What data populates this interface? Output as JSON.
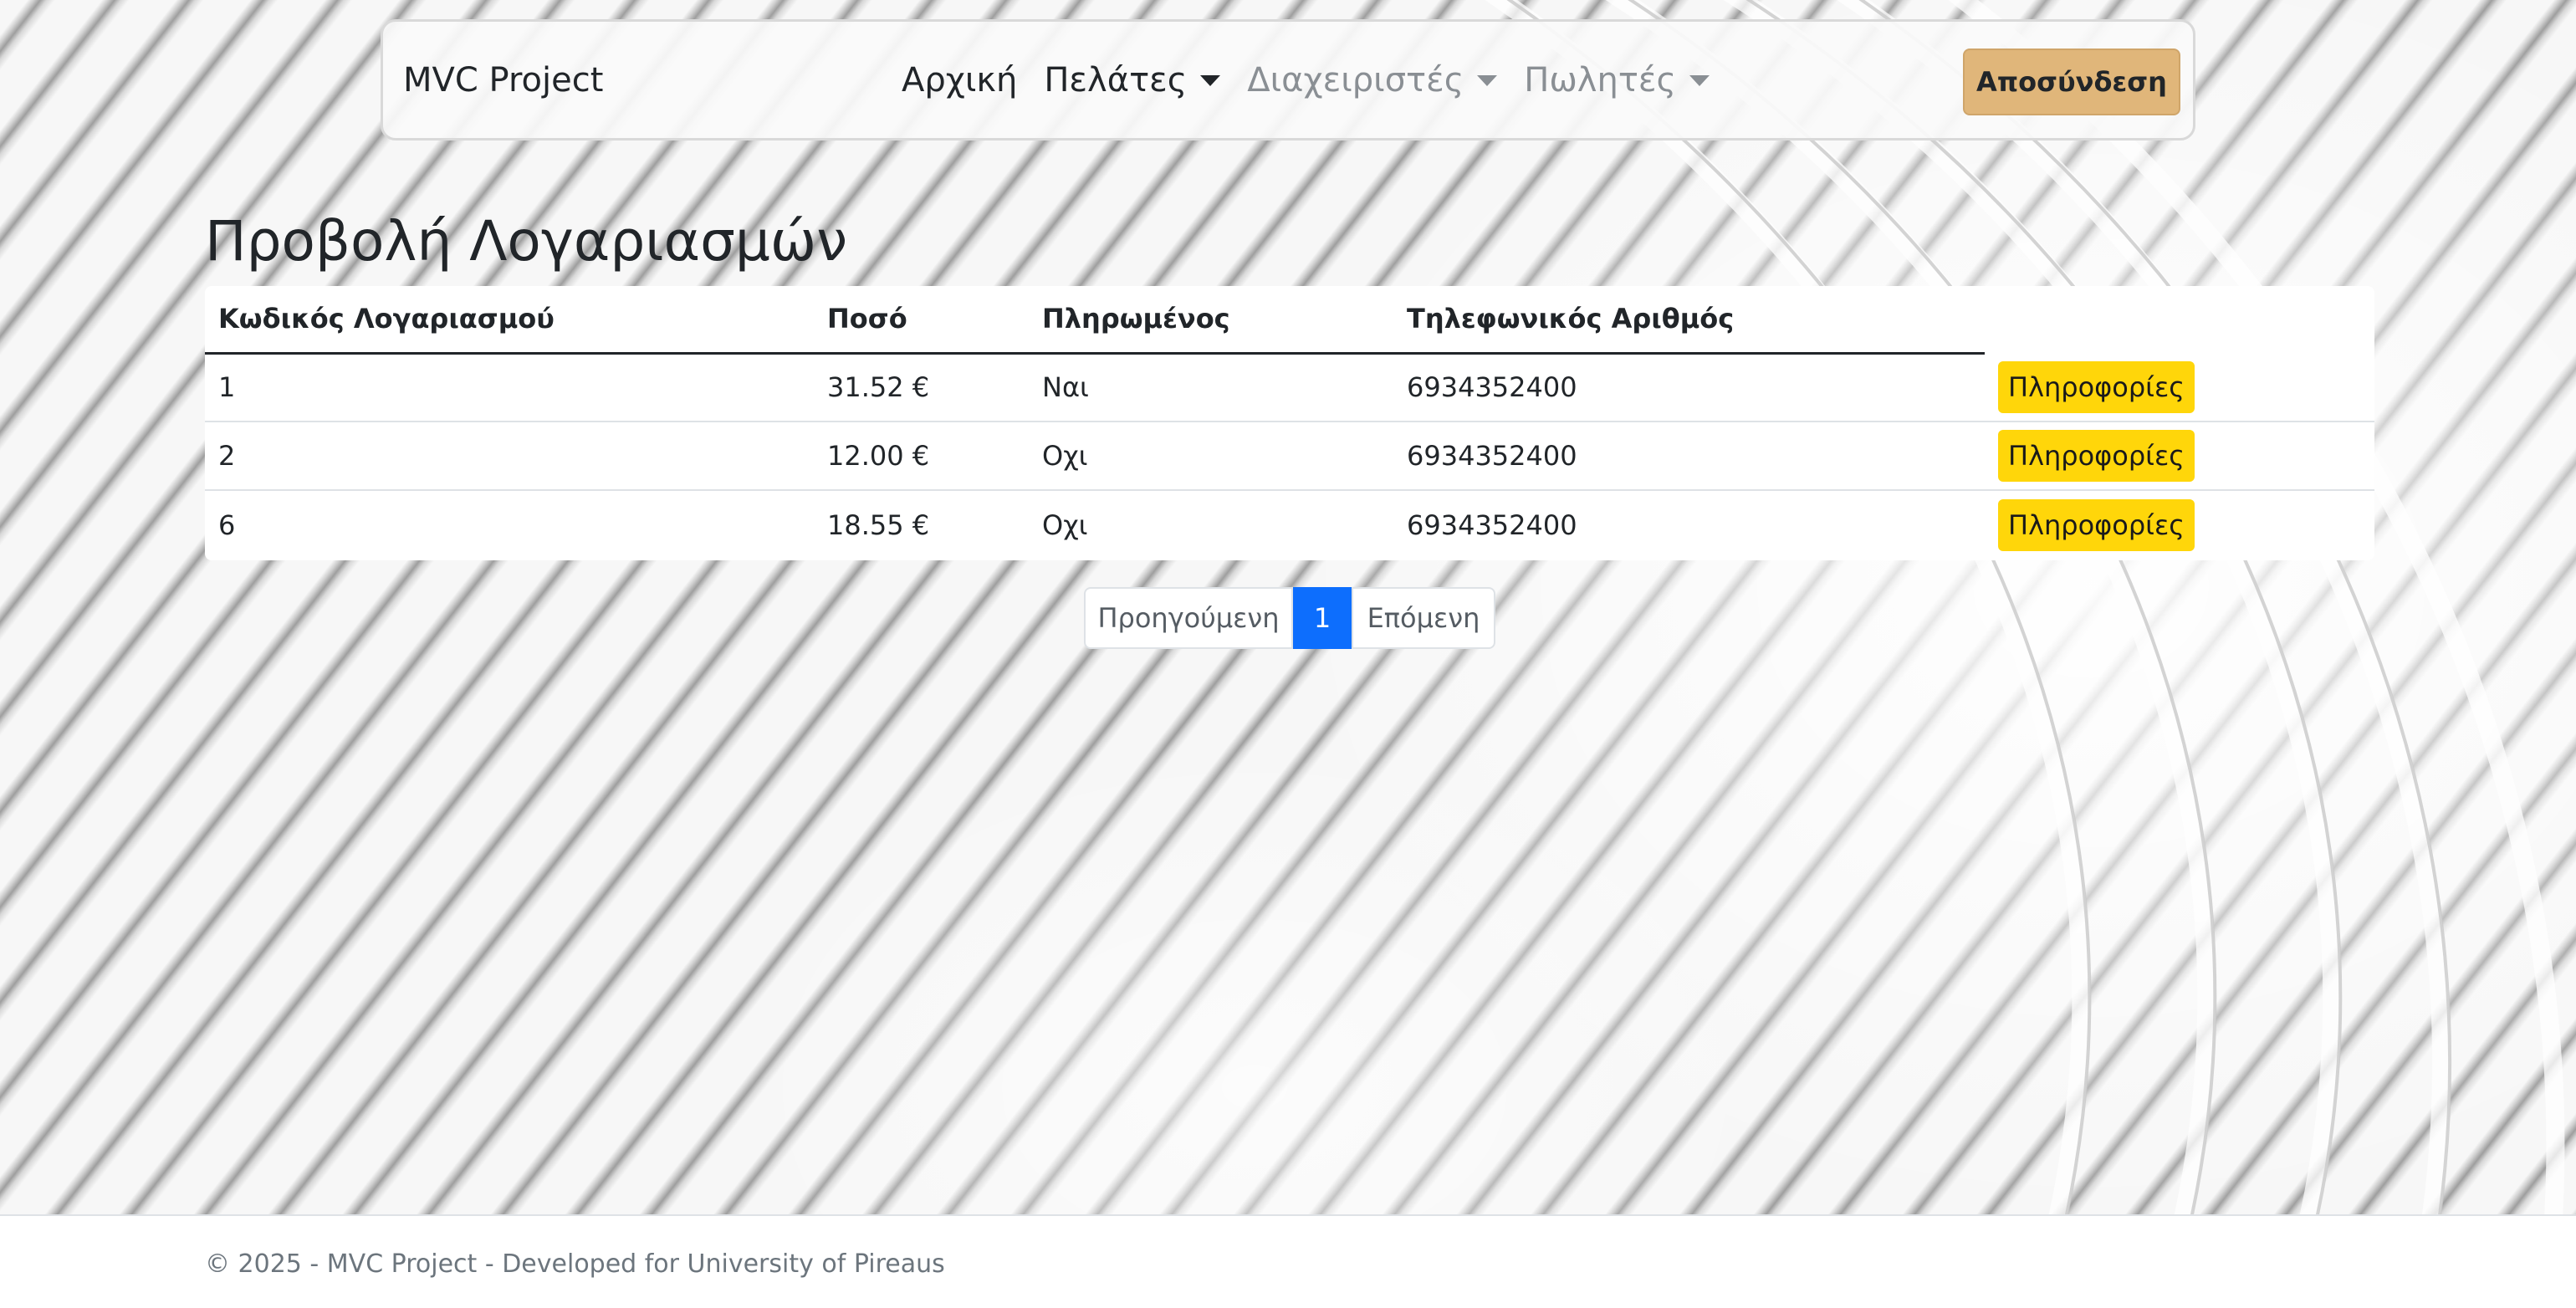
{
  "navbar": {
    "brand": "MVC Project",
    "items": [
      {
        "label": "Αρχική"
      },
      {
        "label": "Πελάτες"
      },
      {
        "label": "Διαχειριστές"
      },
      {
        "label": "Πωλητές"
      }
    ],
    "logout_label": "Αποσύνδεση"
  },
  "page": {
    "title": "Προβολή Λογαριασμών"
  },
  "table": {
    "headers": [
      "Κωδικός Λογαριασμού",
      "Ποσό",
      "Πληρωμένος",
      "Τηλεφωνικός Αριθμός"
    ],
    "rows": [
      {
        "code": "1",
        "amount": "31.52 €",
        "paid": "Ναι",
        "phone": "6934352400",
        "action": "Πληροφορίες"
      },
      {
        "code": "2",
        "amount": "12.00 €",
        "paid": "Οχι",
        "phone": "6934352400",
        "action": "Πληροφορίες"
      },
      {
        "code": "6",
        "amount": "18.55 €",
        "paid": "Οχι",
        "phone": "6934352400",
        "action": "Πληροφορίες"
      }
    ]
  },
  "pagination": {
    "prev": "Προηγούμενη",
    "current": "1",
    "next": "Επόμενη"
  },
  "footer": {
    "text": "© 2025 - MVC Project - Developed for University of Pireaus"
  },
  "colors": {
    "logout_button": "#e0b67a",
    "info_button": "#ffd60a",
    "active_page": "#0d6efd"
  }
}
